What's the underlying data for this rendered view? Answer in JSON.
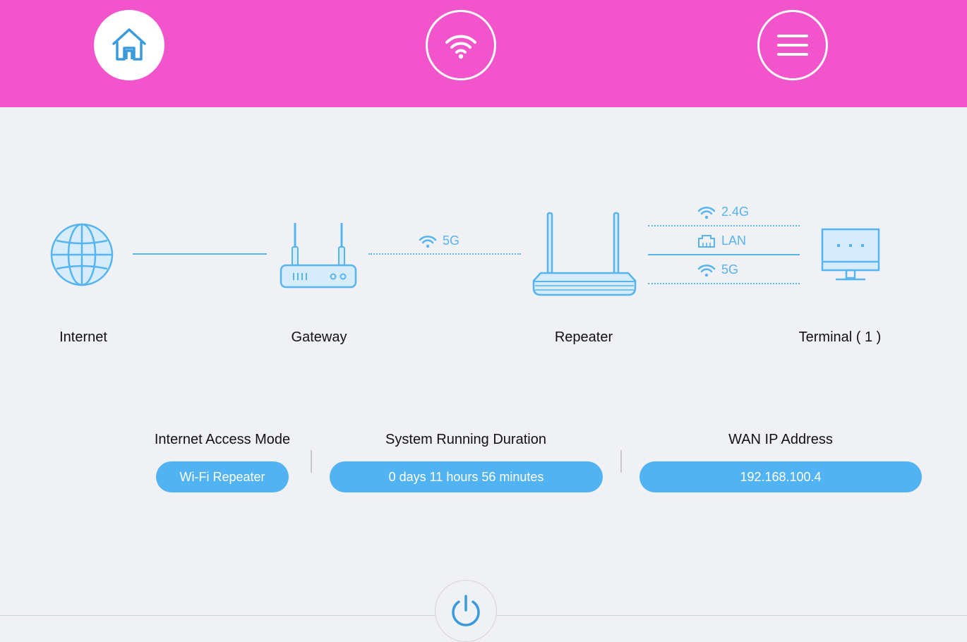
{
  "nav": {
    "items": [
      {
        "icon": "home-icon",
        "active": true
      },
      {
        "icon": "wifi-icon",
        "active": false
      },
      {
        "icon": "menu-icon",
        "active": false
      }
    ]
  },
  "topology": {
    "nodes": [
      {
        "label": "Internet",
        "icon": "globe-icon"
      },
      {
        "label": "Gateway",
        "icon": "router-icon"
      },
      {
        "label": "Repeater",
        "icon": "repeater-icon"
      },
      {
        "label": "Terminal ( 1 )",
        "icon": "monitor-icon"
      }
    ],
    "gateway_link": {
      "band": "5G"
    },
    "terminal_links": [
      {
        "label": "2.4G",
        "icon": "wifi-icon"
      },
      {
        "label": "LAN",
        "icon": "lan-icon"
      },
      {
        "label": "5G",
        "icon": "wifi-icon"
      }
    ]
  },
  "info": {
    "access_mode": {
      "title": "Internet Access Mode",
      "value": "Wi-Fi Repeater"
    },
    "duration": {
      "title": "System Running Duration",
      "value": "0 days 11 hours 56 minutes"
    },
    "wan_ip": {
      "title": "WAN IP Address",
      "value": "192.168.100.4"
    }
  },
  "colors": {
    "topbar": "#f254cb",
    "accent": "#52b3f2",
    "icon_line": "#56b4ef",
    "background": "#f0f1f5"
  }
}
